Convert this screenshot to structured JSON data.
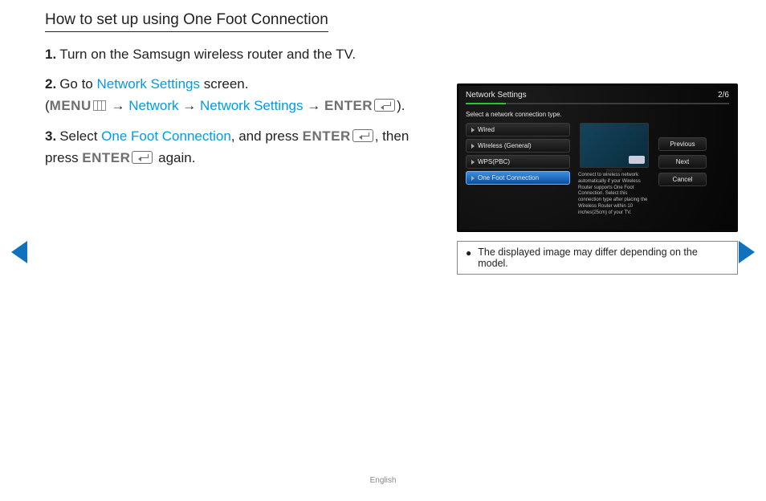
{
  "title": "How to set up using One Foot Connection",
  "steps": {
    "s1": {
      "num": "1.",
      "text": "Turn on the Samsugn wireless router and the TV."
    },
    "s2": {
      "num": "2.",
      "goto": "Go to ",
      "nw_settings": "Network Settings",
      "screen": " screen.",
      "open": "(",
      "menu": "MENU",
      "arrow1": " → ",
      "network": "Network",
      "arrow2": " → ",
      "nw_settings2": "Network Settings",
      "arrow3": " → ",
      "enter": "ENTER",
      "close": ")."
    },
    "s3": {
      "num": "3.",
      "select": "Select ",
      "ofc": "One Foot Connection",
      "and_press": ", and press ",
      "enter": "ENTER",
      "then": ", then press ",
      "enter2": "ENTER",
      "again": " again."
    }
  },
  "tv": {
    "title": "Network Settings",
    "page": "2/6",
    "subtitle": "Select a network connection type.",
    "items": {
      "wired": "Wired",
      "wireless": "Wireless (General)",
      "wps": "WPS(PBC)",
      "ofc": "One Foot Connection"
    },
    "desc": "Connect to wireless network automatically if your Wireless Router supports One Foot Connection. Select this connection type after placing the Wireless Router within 10 inches(25cm) of your TV.",
    "buttons": {
      "prev": "Previous",
      "next": "Next",
      "cancel": "Cancel"
    }
  },
  "note": "The displayed image may differ depending on the model.",
  "footer": "English"
}
